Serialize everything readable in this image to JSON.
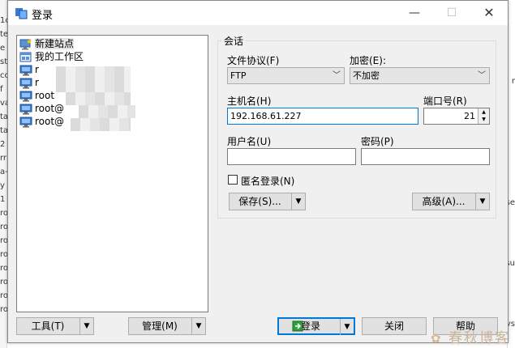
{
  "background": {
    "left_fragments": [
      "1c",
      "te",
      "e",
      "sta",
      "cou",
      "f",
      "va",
      "ta",
      "ta",
      "2",
      "rr",
      "a-",
      "y",
      "1",
      "ro",
      "ro",
      "ro",
      "ro",
      "ro",
      "ro",
      "ro",
      "ro"
    ],
    "right_fragments": [
      "r",
      "se",
      "su",
      "ys"
    ]
  },
  "window": {
    "title": "登录",
    "controls": {
      "minimize": "—",
      "maximize": "☐",
      "close": "✕"
    }
  },
  "sites": {
    "items": [
      {
        "label": "新建站点",
        "icon": "new-site-icon",
        "selected": true
      },
      {
        "label": "我的工作区",
        "icon": "workspace-icon",
        "selected": false
      },
      {
        "label": "r",
        "icon": "computer-icon",
        "selected": false
      },
      {
        "label": "r",
        "icon": "computer-icon",
        "selected": false
      },
      {
        "label": "root",
        "icon": "computer-icon",
        "selected": false
      },
      {
        "label": "root@",
        "icon": "computer-icon",
        "selected": false
      },
      {
        "label": "root@",
        "icon": "computer-icon",
        "selected": false
      }
    ]
  },
  "left_buttons": {
    "tools": "工具(T)",
    "manage": "管理(M)"
  },
  "session": {
    "group_title": "会话",
    "protocol_label": "文件协议(F)",
    "protocol_value": "FTP",
    "encryption_label": "加密(E):",
    "encryption_value": "不加密",
    "host_label": "主机名(H)",
    "host_value": "192.168.61.227",
    "port_label": "端口号(R)",
    "port_value": "21",
    "user_label": "用户名(U)",
    "user_value": "",
    "password_label": "密码(P)",
    "password_value": "",
    "anonymous_label": "匿名登录(N)",
    "anonymous_checked": false,
    "save_button": "保存(S)...",
    "advanced_button": "高级(A)..."
  },
  "footer": {
    "login": "登录",
    "close": "关闭",
    "help": "帮助"
  },
  "watermark": "春秋博客",
  "colors": {
    "accent": "#0078d7",
    "dialog_bg": "#f0f0f0"
  }
}
